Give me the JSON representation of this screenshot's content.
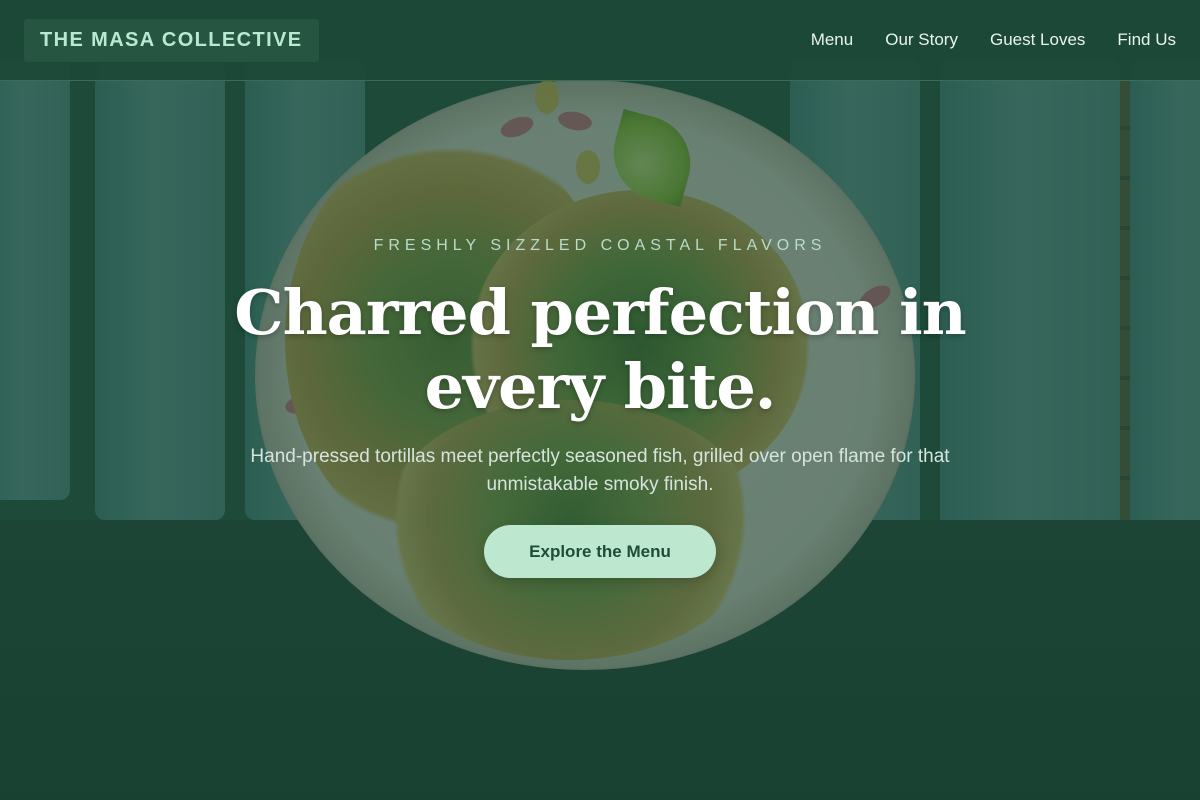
{
  "header": {
    "brand": "THE MASA COLLECTIVE",
    "nav": [
      {
        "label": "Menu"
      },
      {
        "label": "Our Story"
      },
      {
        "label": "Guest Loves"
      },
      {
        "label": "Find Us"
      }
    ]
  },
  "hero": {
    "eyebrow": "FRESHLY SIZZLED COASTAL FLAVORS",
    "headline": "Charred perfection in every bite.",
    "subtext": "Hand-pressed tortillas meet perfectly seasoned fish, grilled over open flame for that unmistakable smoky finish.",
    "cta_label": "Explore the Menu",
    "background_image": "fish-tacos-photo"
  },
  "colors": {
    "overlay": "#1c4636",
    "brand_text": "#b8ead2",
    "cta_background": "#bde8cf",
    "cta_text": "#1f4b39"
  }
}
